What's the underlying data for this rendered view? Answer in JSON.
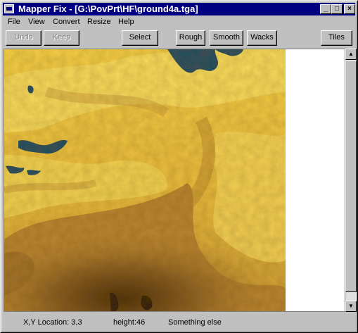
{
  "window": {
    "title": "Mapper Fix - [G:\\PovPrt\\HF\\ground4a.tga]",
    "controls": {
      "minimize": "_",
      "maximize": "□",
      "close": "×"
    }
  },
  "menu": [
    {
      "label": "File"
    },
    {
      "label": "View"
    },
    {
      "label": "Convert"
    },
    {
      "label": "Resize"
    },
    {
      "label": "Help"
    }
  ],
  "toolbar": {
    "undo": "Undo",
    "keep": "Keep",
    "select": "Select",
    "rough": "Rough",
    "smooth": "Smooth",
    "wacks": "Wacks",
    "tiles": "Tiles"
  },
  "scrollbar": {
    "up_icon": "▲",
    "down_icon": "▼"
  },
  "status": {
    "location": "X,Y Location: 3,3",
    "height": "height:46",
    "extra": "Something else"
  },
  "colors": {
    "titlebar": "#000080",
    "terrain_light": "#f4d24a",
    "terrain_mid": "#c8963a",
    "terrain_dark": "#5a3a14",
    "water": "#0b4d5e"
  }
}
